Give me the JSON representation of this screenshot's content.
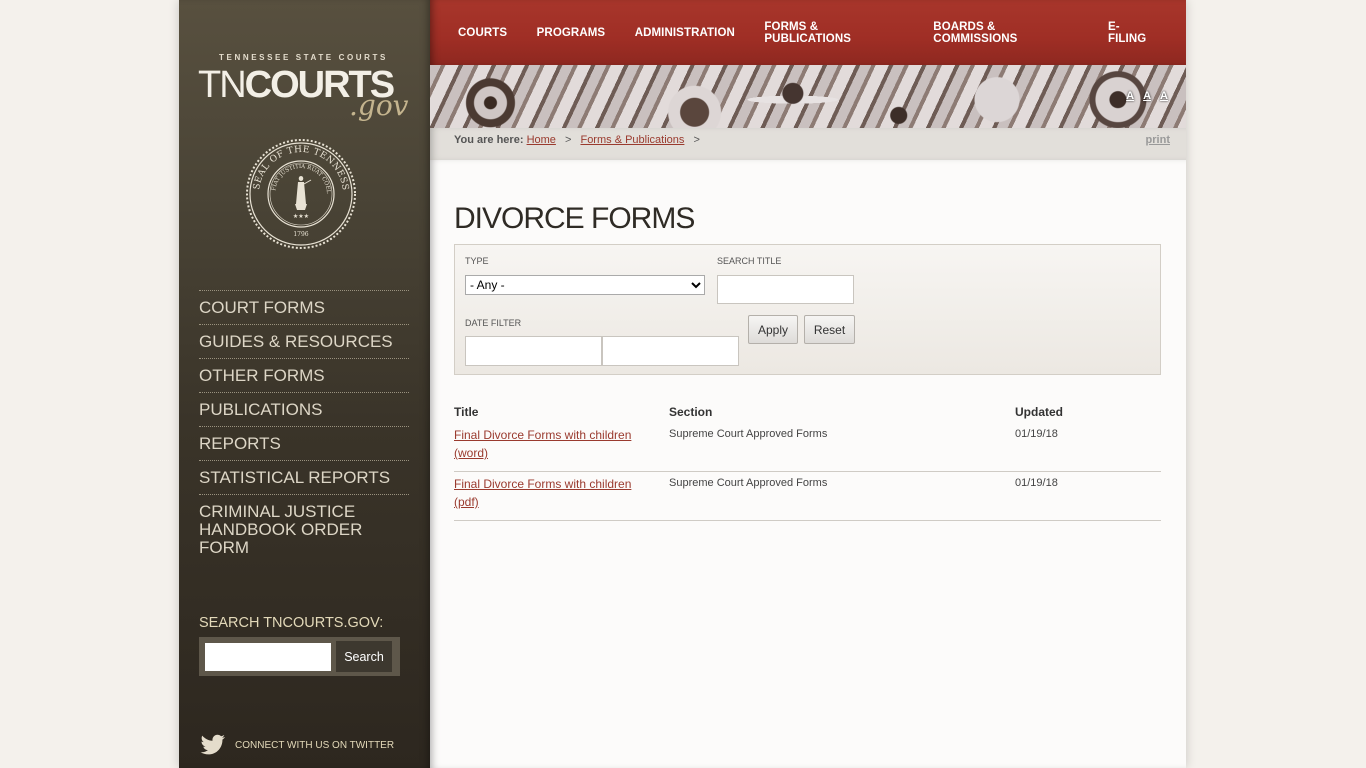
{
  "brand": {
    "tagline": "TENNESSEE STATE COURTS",
    "name_part1": "TN",
    "name_part2": "COURTS",
    "suffix": ".gov",
    "seal_text": "SEAL OF THE TENNESSEE JUDICIARY",
    "seal_motto": "FIAT JUSTITIA RUAT COELUM",
    "seal_year": "1796"
  },
  "topnav": {
    "items": [
      "COURTS",
      "PROGRAMS",
      "ADMINISTRATION",
      "FORMS & PUBLICATIONS",
      "BOARDS & COMMISSIONS",
      "E-FILING"
    ]
  },
  "font_size_controls": [
    "A",
    "A",
    "A"
  ],
  "breadcrumb": {
    "prefix": "You are here:",
    "items": [
      "Home",
      "Forms & Publications"
    ],
    "separator": ">",
    "print_label": "print"
  },
  "sidebar": {
    "items": [
      "COURT FORMS",
      "GUIDES & RESOURCES",
      "OTHER FORMS",
      "PUBLICATIONS",
      "REPORTS",
      "STATISTICAL REPORTS",
      "CRIMINAL JUSTICE HANDBOOK ORDER FORM"
    ],
    "search_label": "SEARCH TNCOURTS.GOV:",
    "search_value": "",
    "search_button": "Search",
    "twitter_label": "CONNECT WITH US ON TWITTER"
  },
  "page": {
    "title": "DIVORCE FORMS"
  },
  "filters": {
    "type_label": "TYPE",
    "type_selected": "- Any -",
    "search_title_label": "SEARCH TITLE",
    "search_title_value": "",
    "date_filter_label": "DATE FILTER",
    "date_from": "",
    "date_to": "",
    "apply_label": "Apply",
    "reset_label": "Reset"
  },
  "results": {
    "columns": [
      "Title",
      "Section",
      "Updated"
    ],
    "rows": [
      {
        "title": "Final Divorce Forms with children (word)",
        "section": "Supreme Court Approved Forms",
        "updated": "01/19/18"
      },
      {
        "title": "Final Divorce Forms with children (pdf)",
        "section": "Supreme Court Approved Forms",
        "updated": "01/19/18"
      }
    ]
  },
  "colors": {
    "nav_red": "#a03028",
    "sidebar_brown": "#3a3429",
    "link_red": "#9a3a2e",
    "gov_gold": "#c4b48e"
  }
}
